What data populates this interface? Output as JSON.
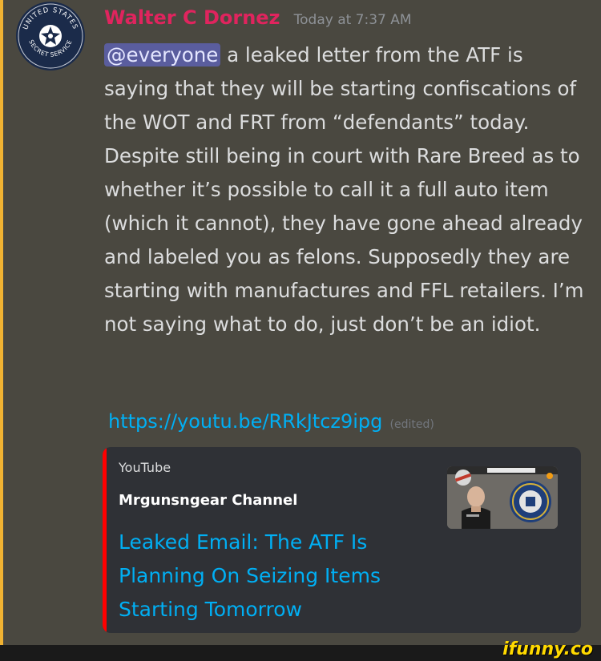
{
  "user": {
    "name": "Walter C Dornez",
    "timestamp": "Today at 7:37 AM",
    "avatar_text_top": "UNITED STATES",
    "avatar_text_bottom": "SECRET SERVICE"
  },
  "message": {
    "mention": "@everyone",
    "text": " a leaked letter from the ATF is saying that they will be starting confiscations of the WOT and FRT from “defendants” today. Despite still being in court with Rare Breed as to whether it’s possible to call it a full auto item (which it cannot), they have gone ahead already and labeled you as felons. Supposedly they are starting with manufactures and FFL retailers. I’m not saying what to do, just don’t be an idiot.",
    "link": "https://youtu.be/RRkJtcz9ipg",
    "edited_label": "(edited)"
  },
  "embed": {
    "provider": "YouTube",
    "author": "Mrgunsngear Channel",
    "title": "Leaked Email: The ATF Is Planning On Seizing Items Starting Tomorrow",
    "accent_color": "#ff0000"
  },
  "watermark": "ifunny.co"
}
